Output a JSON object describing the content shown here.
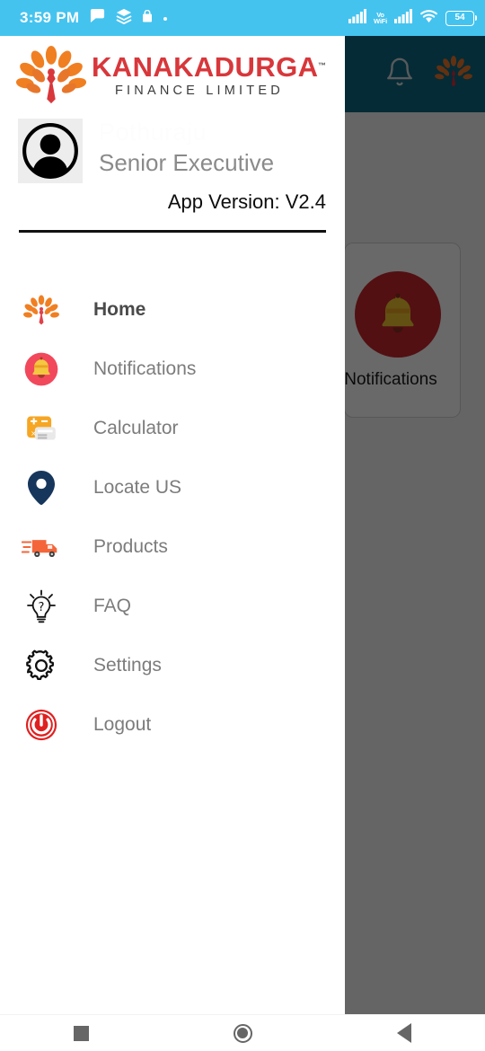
{
  "status_bar": {
    "time": "3:59 PM",
    "battery_level": "54",
    "network_label": "Vo\nWiFi",
    "left_icons": [
      "message-icon",
      "layers-icon",
      "lock-icon",
      "dot-icon"
    ],
    "right_icons": [
      "signal-bars-icon",
      "vowifi-icon",
      "signal-bars-icon",
      "wifi-icon",
      "battery-icon"
    ],
    "background": "#44c3ef"
  },
  "drawer": {
    "logo": {
      "title": "KANAKADURGA",
      "subtitle": "FINANCE LIMITED",
      "trademark": "™",
      "emblem": "kanakadurga-tree-emblem",
      "title_color": "#d8373b"
    },
    "profile": {
      "user_name": "Pothuraju",
      "role": "Senior Executive",
      "app_version": "App Version: V2.4",
      "avatar": "user-avatar-icon"
    },
    "menu": [
      {
        "label": "Home",
        "icon": "home-tree-icon",
        "active": true
      },
      {
        "label": "Notifications",
        "icon": "bell-icon",
        "active": false
      },
      {
        "label": "Calculator",
        "icon": "calculator-icon",
        "active": false
      },
      {
        "label": "Locate US",
        "icon": "map-pin-icon",
        "active": false
      },
      {
        "label": "Products",
        "icon": "delivery-truck-icon",
        "active": false
      },
      {
        "label": "FAQ",
        "icon": "lightbulb-faq-icon",
        "active": false
      },
      {
        "label": "Settings",
        "icon": "gear-icon",
        "active": false
      },
      {
        "label": "Logout",
        "icon": "power-icon",
        "active": false
      }
    ]
  },
  "app_behind": {
    "app_bar": {
      "background": "#0e6680",
      "bell_icon": "bell-outline-icon",
      "logo_icon": "kanakadurga-tree-emblem"
    },
    "tile": {
      "label": "Notifications",
      "icon": "bell-icon",
      "circle_color": "#c4282c"
    }
  },
  "nav_bar": {
    "recents_label": "recents-square-icon",
    "home_label": "home-circle-icon",
    "back_label": "back-triangle-icon"
  }
}
